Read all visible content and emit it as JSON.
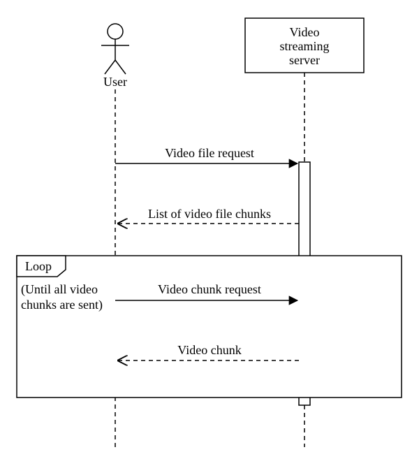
{
  "actors": {
    "user": {
      "label": "User"
    },
    "server": {
      "label_line1": "Video",
      "label_line2": "streaming",
      "label_line3": "server"
    }
  },
  "messages": {
    "m1": "Video file request",
    "m2": "List of video file chunks",
    "m3": "Video chunk request",
    "m4": "Video chunk"
  },
  "loop": {
    "title": "Loop",
    "guard_line1": "(Until all video",
    "guard_line2": "chunks are sent)"
  }
}
